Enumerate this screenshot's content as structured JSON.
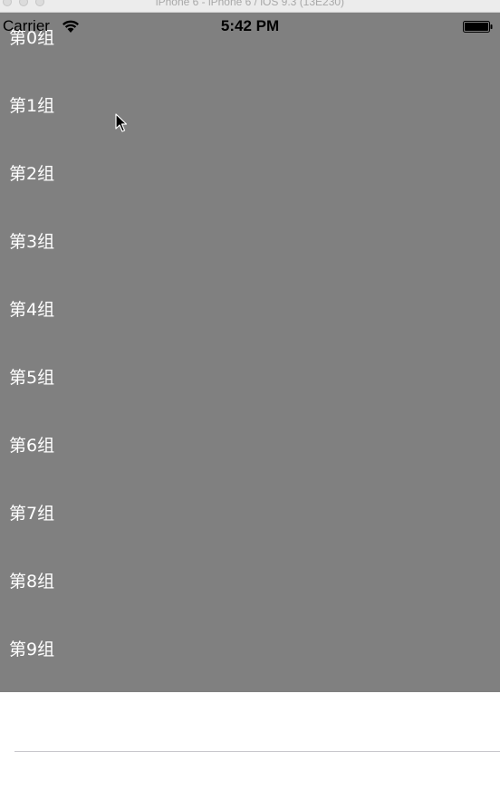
{
  "window": {
    "title": "iPhone 6 - iPhone 6 / iOS 9.3 (13E230)"
  },
  "status_bar": {
    "carrier": "Carrier",
    "time": "5:42 PM",
    "wifi_icon": "wifi-icon",
    "battery_icon": "battery-icon"
  },
  "groups": [
    {
      "label": "第0组"
    },
    {
      "label": "第1组"
    },
    {
      "label": "第2组"
    },
    {
      "label": "第3组"
    },
    {
      "label": "第4组"
    },
    {
      "label": "第5组"
    },
    {
      "label": "第6组"
    },
    {
      "label": "第7组"
    },
    {
      "label": "第8组"
    },
    {
      "label": "第9组"
    }
  ],
  "colors": {
    "overlay": "#808080",
    "label": "#ffffff",
    "background": "#ffffff",
    "separator": "#c8c7cc"
  }
}
